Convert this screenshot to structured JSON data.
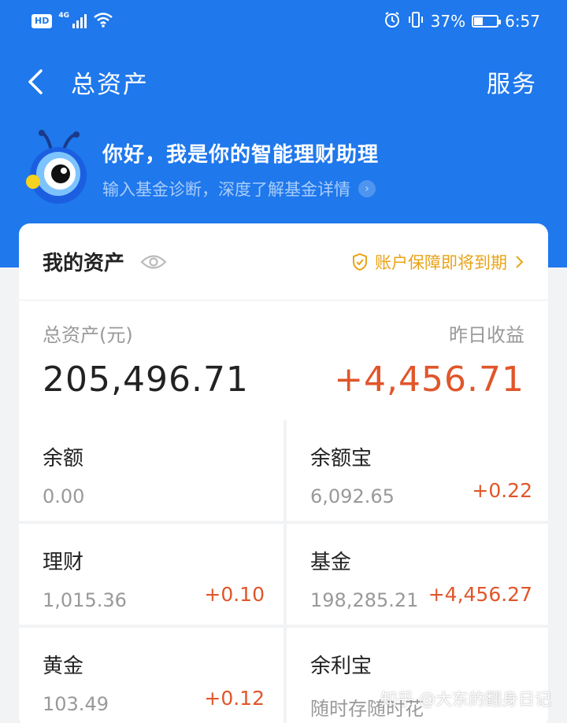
{
  "status_bar": {
    "hd": "HD",
    "network": "4G",
    "battery_text": "37%",
    "time": "6:57"
  },
  "nav": {
    "title": "总资产",
    "service": "服务"
  },
  "assistant": {
    "greeting": "你好，我是你的智能理财助理",
    "subtitle": "输入基金诊断，深度了解基金详情"
  },
  "card": {
    "title": "我的资产",
    "protection_notice": "账户保障即将到期",
    "total_label": "总资产(元)",
    "total_value": "205,496.71",
    "yesterday_label": "昨日收益",
    "yesterday_value": "+4,456.71"
  },
  "assets": [
    {
      "name": "余额",
      "amount": "0.00",
      "gain": ""
    },
    {
      "name": "余额宝",
      "amount": "6,092.65",
      "gain": "+0.22"
    },
    {
      "name": "理财",
      "amount": "1,015.36",
      "gain": "+0.10"
    },
    {
      "name": "基金",
      "amount": "198,285.21",
      "gain": "+4,456.27"
    },
    {
      "name": "黄金",
      "amount": "103.49",
      "gain": "+0.12"
    },
    {
      "name": "余利宝",
      "amount": "随时存随时花",
      "gain": ""
    }
  ],
  "watermark": "知乎 @大东的翻身日记",
  "colors": {
    "brand_blue": "#1f78ec",
    "gain_red": "#e0562a",
    "warning_gold": "#e8a317"
  }
}
